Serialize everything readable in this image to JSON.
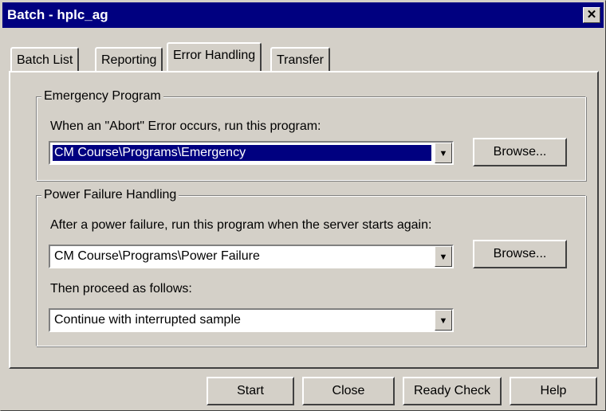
{
  "window": {
    "title": "Batch - hplc_ag",
    "close_glyph": "✕"
  },
  "tabs": [
    {
      "label": "Batch List"
    },
    {
      "label": "Reporting"
    },
    {
      "label": "Error Handling"
    },
    {
      "label": "Transfer"
    }
  ],
  "emergency": {
    "group_title": "Emergency Program",
    "prompt": "When an \"Abort\" Error occurs, run this program:",
    "program_value": "CM Course\\Programs\\Emergency",
    "browse_label": "Browse..."
  },
  "power_failure": {
    "group_title": "Power Failure Handling",
    "prompt": "After a power failure, run this program when the server starts again:",
    "program_value": "CM Course\\Programs\\Power Failure",
    "browse_label": "Browse...",
    "proceed_prompt": "Then proceed as follows:",
    "proceed_value": "Continue with interrupted sample"
  },
  "footer": {
    "start_label": "Start",
    "close_label": "Close",
    "ready_check_label": "Ready Check",
    "help_label": "Help"
  },
  "icons": {
    "dropdown": "chevron-down-icon",
    "close": "close-icon"
  }
}
